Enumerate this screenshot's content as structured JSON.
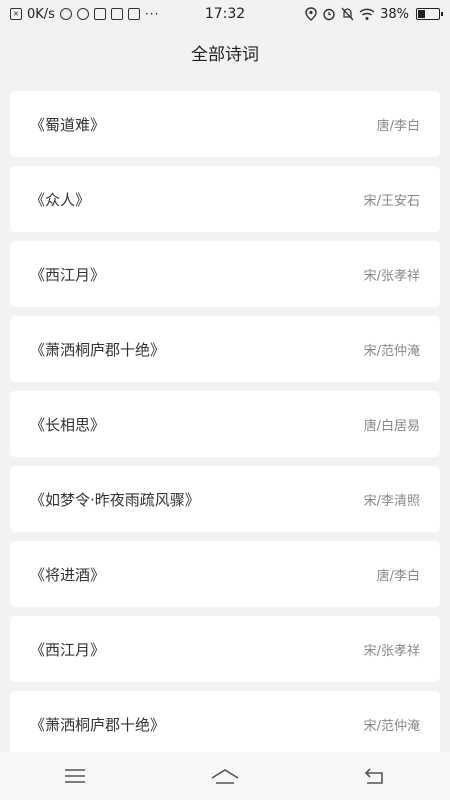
{
  "status_bar": {
    "net_speed": "0K/s",
    "time": "17:32",
    "battery_percent": "38%",
    "battery_level": 0.38,
    "left_icons": [
      "close-box-icon",
      "cloud-icon",
      "planet-icon",
      "shield-icon",
      "mail-icon",
      "app-icon"
    ],
    "right_icons": [
      "location-icon",
      "alarm-icon",
      "mute-icon",
      "wifi-icon"
    ],
    "more": "···"
  },
  "header": {
    "title": "全部诗词"
  },
  "poems": [
    {
      "title": "《蜀道难》",
      "author": "唐/李白"
    },
    {
      "title": "《众人》",
      "author": "宋/王安石"
    },
    {
      "title": "《西江月》",
      "author": "宋/张孝祥"
    },
    {
      "title": "《萧洒桐庐郡十绝》",
      "author": "宋/范仲淹"
    },
    {
      "title": "《长相思》",
      "author": "唐/白居易"
    },
    {
      "title": "《如梦令·昨夜雨疏风骤》",
      "author": "宋/李清照"
    },
    {
      "title": "《将进酒》",
      "author": "唐/李白"
    },
    {
      "title": "《西江月》",
      "author": "宋/张孝祥"
    },
    {
      "title": "《萧洒桐庐郡十绝》",
      "author": "宋/范仲淹"
    }
  ],
  "nav": {
    "menu_icon": "menu-icon",
    "home_icon": "home-icon",
    "back_icon": "back-icon"
  }
}
